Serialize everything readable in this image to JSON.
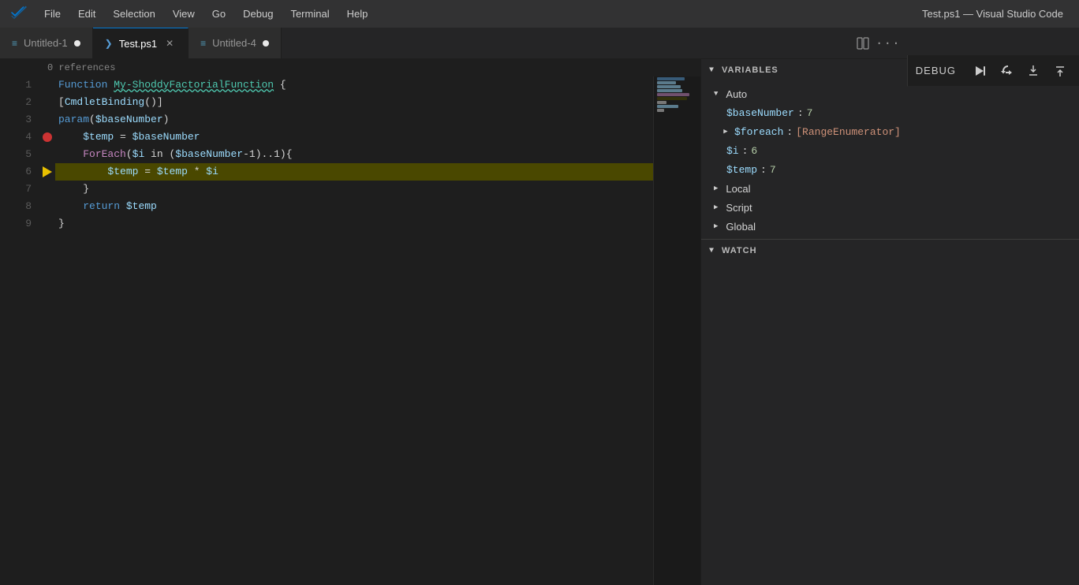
{
  "titlebar": {
    "icon": "VS",
    "menu": [
      "File",
      "Edit",
      "Selection",
      "View",
      "Go",
      "Debug",
      "Terminal",
      "Help"
    ],
    "title": "Test.ps1 — Visual Studio Code"
  },
  "tabs": [
    {
      "id": "untitled1",
      "label": "Untitled-1",
      "icon": "≡",
      "modified": true,
      "active": false
    },
    {
      "id": "testps1",
      "label": "Test.ps1",
      "icon": "PS",
      "modified": false,
      "active": true,
      "closable": true
    },
    {
      "id": "untitled4",
      "label": "Untitled-4",
      "icon": "≡",
      "modified": true,
      "active": false
    }
  ],
  "debug": {
    "label": "DEBUG",
    "buttons": [
      "continue",
      "step-over",
      "step-into",
      "step-out"
    ]
  },
  "editor": {
    "references_label": "0 references",
    "lines": [
      {
        "num": 1,
        "content": "Function My-ShoddyFactorialFunction {"
      },
      {
        "num": 2,
        "content": "[CmdletBinding()]"
      },
      {
        "num": 3,
        "content": "param($baseNumber)"
      },
      {
        "num": 4,
        "content": "    $temp = $baseNumber",
        "breakpoint": true
      },
      {
        "num": 5,
        "content": "    ForEach($i in ($baseNumber-1)..1){"
      },
      {
        "num": 6,
        "content": "        $temp = $temp * $i",
        "current": true,
        "highlighted": true
      },
      {
        "num": 7,
        "content": "    }"
      },
      {
        "num": 8,
        "content": "    return $temp"
      },
      {
        "num": 9,
        "content": "}"
      }
    ]
  },
  "variables_panel": {
    "title": "VARIABLES",
    "sections": [
      {
        "name": "Auto",
        "expanded": true,
        "items": [
          {
            "name": "$baseNumber",
            "value": "7",
            "expandable": false
          },
          {
            "name": "$foreach",
            "value": "[RangeEnumerator]",
            "expandable": true
          },
          {
            "name": "$i",
            "value": "6",
            "expandable": false
          },
          {
            "name": "$temp",
            "value": "7",
            "expandable": false
          }
        ]
      },
      {
        "name": "Local",
        "expanded": false
      },
      {
        "name": "Script",
        "expanded": false
      },
      {
        "name": "Global",
        "expanded": false
      }
    ]
  },
  "watch_panel": {
    "title": "WATCH"
  }
}
